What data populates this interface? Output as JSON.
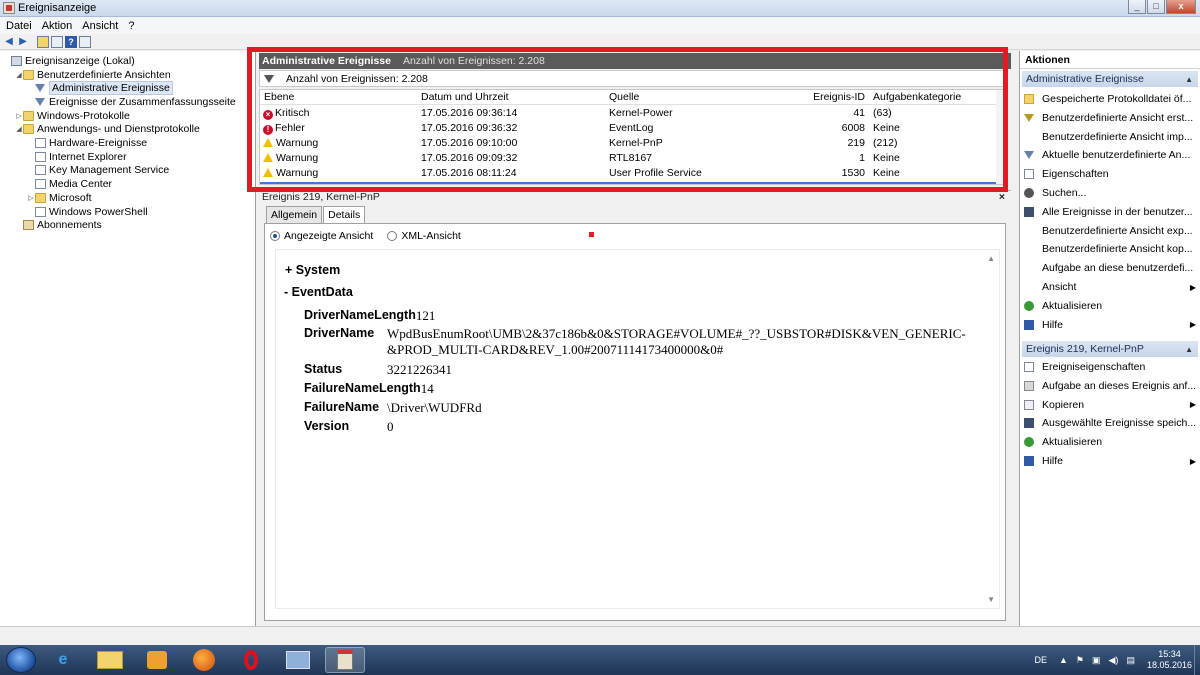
{
  "window": {
    "title": "Ereignisanzeige",
    "btn_min": "_",
    "btn_max": "□",
    "btn_close": "x"
  },
  "menu": [
    "Datei",
    "Aktion",
    "Ansicht",
    "?"
  ],
  "toolbar": {
    "icons": [
      "back-icon",
      "forward-icon",
      "folder-up-icon",
      "console-tree-icon",
      "help-icon",
      "view-icon"
    ],
    "back": "◀",
    "forward": "▶",
    "help": "?"
  },
  "tree": [
    {
      "label": "Ereignisanzeige (Lokal)",
      "icon": "pc-icon",
      "twisty": "",
      "indent": 0
    },
    {
      "label": "Benutzerdefinierte Ansichten",
      "icon": "folder-icon",
      "twisty": "◢",
      "indent": 1
    },
    {
      "label": "Administrative Ereignisse",
      "icon": "filter-icon",
      "twisty": "",
      "indent": 2,
      "selected": true
    },
    {
      "label": "Ereignisse der Zusammenfassungsseite",
      "icon": "filter-icon",
      "twisty": "",
      "indent": 2
    },
    {
      "label": "Windows-Protokolle",
      "icon": "folder-icon",
      "twisty": "▷",
      "indent": 1
    },
    {
      "label": "Anwendungs- und Dienstprotokolle",
      "icon": "folder-icon",
      "twisty": "◢",
      "indent": 1
    },
    {
      "label": "Hardware-Ereignisse",
      "icon": "log-icon",
      "twisty": "",
      "indent": 2
    },
    {
      "label": "Internet Explorer",
      "icon": "log-icon",
      "twisty": "",
      "indent": 2
    },
    {
      "label": "Key Management Service",
      "icon": "log-icon",
      "twisty": "",
      "indent": 2
    },
    {
      "label": "Media Center",
      "icon": "log-icon",
      "twisty": "",
      "indent": 2
    },
    {
      "label": "Microsoft",
      "icon": "folder-icon",
      "twisty": "▷",
      "indent": 2
    },
    {
      "label": "Windows PowerShell",
      "icon": "log-icon",
      "twisty": "",
      "indent": 2
    },
    {
      "label": "Abonnements",
      "icon": "subscriptions-icon",
      "twisty": "",
      "indent": 1
    }
  ],
  "center": {
    "header_title": "Administrative Ereignisse",
    "header_count": "Anzahl von Ereignissen: 2.208",
    "filter_text": "Anzahl von Ereignissen: 2.208",
    "columns": {
      "level": "Ebene",
      "datetime": "Datum und Uhrzeit",
      "source": "Quelle",
      "id": "Ereignis-ID",
      "category": "Aufgabenkategorie"
    },
    "rows": [
      {
        "level": "Kritisch",
        "level_type": "critical",
        "datetime": "17.05.2016 09:36:14",
        "source": "Kernel-Power",
        "id": "41",
        "category": "(63)"
      },
      {
        "level": "Fehler",
        "level_type": "error",
        "datetime": "17.05.2016 09:36:32",
        "source": "EventLog",
        "id": "6008",
        "category": "Keine"
      },
      {
        "level": "Warnung",
        "level_type": "warning",
        "datetime": "17.05.2016 09:10:00",
        "source": "Kernel-PnP",
        "id": "219",
        "category": "(212)"
      },
      {
        "level": "Warnung",
        "level_type": "warning",
        "datetime": "17.05.2016 09:09:32",
        "source": "RTL8167",
        "id": "1",
        "category": "Keine"
      },
      {
        "level": "Warnung",
        "level_type": "warning",
        "datetime": "17.05.2016 08:11:24",
        "source": "User Profile Service",
        "id": "1530",
        "category": "Keine"
      }
    ],
    "event_title": "Ereignis 219, Kernel-PnP",
    "event_close": "×",
    "tabs": [
      "Allgemein",
      "Details"
    ],
    "active_tab": "Details",
    "radio_friendly": "Angezeigte Ansicht",
    "radio_xml": "XML-Ansicht",
    "system_label": "+ System",
    "eventdata_label": "-  EventData",
    "fields": [
      {
        "key": "DriverNameLength",
        "value": "121"
      },
      {
        "key": "DriverName",
        "value": "WpdBusEnumRoot\\UMB\\2&37c186b&0&STORAGE#VOLUME#_??_USBSTOR#DISK&VEN_GENERIC-",
        "value2": "&PROD_MULTI-CARD&REV_1.00#20071114173400000&0#"
      },
      {
        "key": "Status",
        "value": "3221226341"
      },
      {
        "key": "FailureNameLength",
        "value": "14"
      },
      {
        "key": "FailureName",
        "value": "\\Driver\\WUDFRd"
      },
      {
        "key": "Version",
        "value": "0"
      }
    ]
  },
  "actions": {
    "title": "Aktionen",
    "section1": "Administrative Ereignisse",
    "items1": [
      {
        "label": "Gespeicherte Protokolldatei öf...",
        "icon": "open-log-icon",
        "arrow": false
      },
      {
        "label": "Benutzerdefinierte Ansicht erst...",
        "icon": "create-view-icon",
        "arrow": false
      },
      {
        "label": "Benutzerdefinierte Ansicht imp...",
        "icon": "",
        "arrow": false
      },
      {
        "label": "Aktuelle benutzerdefinierte An...",
        "icon": "filter-icon",
        "arrow": false
      },
      {
        "label": "Eigenschaften",
        "icon": "properties-icon",
        "arrow": false
      },
      {
        "label": "Suchen...",
        "icon": "find-icon",
        "arrow": false
      },
      {
        "label": "Alle Ereignisse in der benutzer...",
        "icon": "save-icon",
        "arrow": false
      },
      {
        "label": "Benutzerdefinierte Ansicht exp...",
        "icon": "",
        "arrow": false
      },
      {
        "label": "Benutzerdefinierte Ansicht kop...",
        "icon": "",
        "arrow": false
      },
      {
        "label": "Aufgabe an diese benutzerdefi...",
        "icon": "",
        "arrow": false
      },
      {
        "label": "Ansicht",
        "icon": "",
        "arrow": true
      },
      {
        "label": "Aktualisieren",
        "icon": "refresh-icon",
        "arrow": false
      },
      {
        "label": "Hilfe",
        "icon": "help-icon",
        "arrow": true
      }
    ],
    "section2": "Ereignis 219, Kernel-PnP",
    "items2": [
      {
        "label": "Ereigniseigenschaften",
        "icon": "properties-icon",
        "arrow": false
      },
      {
        "label": "Aufgabe an dieses Ereignis anf...",
        "icon": "task-icon",
        "arrow": false
      },
      {
        "label": "Kopieren",
        "icon": "copy-icon",
        "arrow": true
      },
      {
        "label": "Ausgewählte Ereignisse speich...",
        "icon": "save-icon",
        "arrow": false
      },
      {
        "label": "Aktualisieren",
        "icon": "refresh-icon",
        "arrow": false
      },
      {
        "label": "Hilfe",
        "icon": "help-icon",
        "arrow": true
      }
    ]
  },
  "taskbar": {
    "apps": [
      "internet-explorer-icon",
      "file-explorer-icon",
      "media-player-icon",
      "firefox-icon",
      "opera-icon",
      "remote-desktop-icon",
      "event-viewer-icon"
    ],
    "lang": "DE",
    "time": "15:34",
    "date": "18.05.2016"
  },
  "colors": {
    "highlight_box": "#e11a24",
    "selected_row": "#3a7bd5",
    "action_header": "#c7d6ea"
  }
}
